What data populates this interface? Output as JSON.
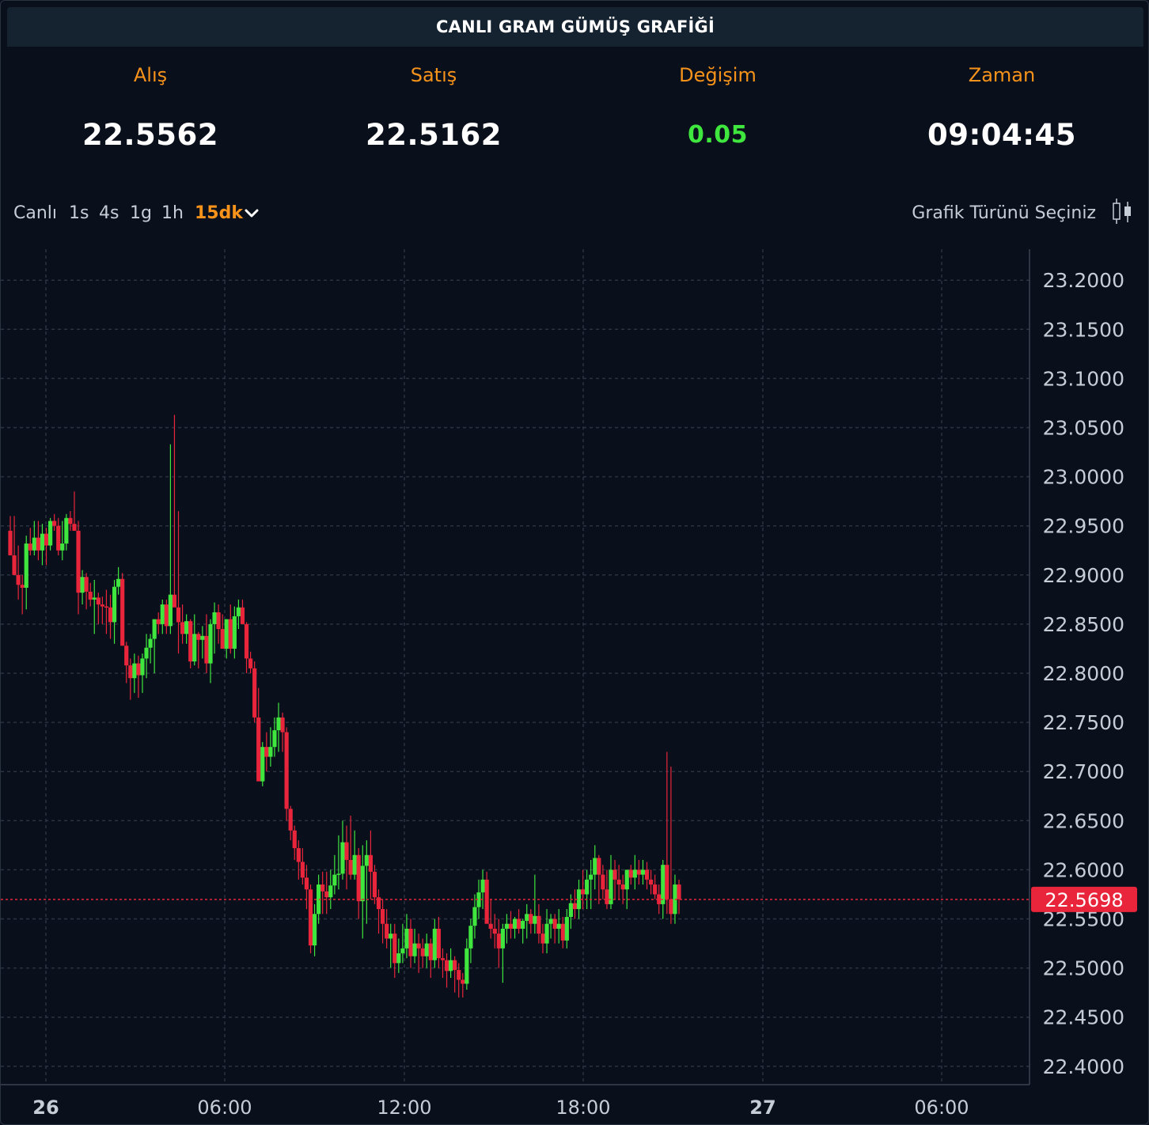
{
  "header": {
    "title": "CANLI GRAM GÜMÜŞ GRAFİĞİ"
  },
  "stats": {
    "buy_label": "Alış",
    "buy_value": "22.5562",
    "sell_label": "Satış",
    "sell_value": "22.5162",
    "change_label": "Değişim",
    "change_value": "0.05",
    "time_label": "Zaman",
    "time_value": "09:04:45"
  },
  "toolbar": {
    "timeframes": [
      "Canlı",
      "1s",
      "4s",
      "1g",
      "1h",
      "15dk"
    ],
    "active_timeframe": "15dk",
    "chart_type_label": "Grafik Türünü Seçiniz",
    "dropdown_icon": "chevron-down-icon",
    "chart_type_icon": "candlestick-icon"
  },
  "colors": {
    "up": "#3ee63e",
    "down": "#e8253a",
    "accent": "#f7931a",
    "background": "#0a0f1c",
    "grid": "#2a3340",
    "current_price_bg": "#e8253a"
  },
  "chart_data": {
    "type": "candlestick",
    "interval": "15dk",
    "y_ticks": [
      "23.2000",
      "23.1500",
      "23.1000",
      "23.0500",
      "23.0000",
      "22.9500",
      "22.9000",
      "22.8500",
      "22.8000",
      "22.7500",
      "22.7000",
      "22.6500",
      "22.6000",
      "22.5500",
      "22.5000",
      "22.4500",
      "22.4000"
    ],
    "ylim": [
      22.39,
      23.225
    ],
    "x_ticks": [
      "26",
      "06:00",
      "12:00",
      "18:00",
      "27",
      "06:00"
    ],
    "x_ticks_bold": [
      "26",
      "27"
    ],
    "current_price": "22.5698",
    "grid": true,
    "candles": [
      [
        22.945,
        22.96,
        22.92,
        22.92
      ],
      [
        22.92,
        22.96,
        22.9,
        22.9
      ],
      [
        22.9,
        22.93,
        22.875,
        22.89
      ],
      [
        22.89,
        22.9,
        22.86,
        22.887
      ],
      [
        22.887,
        22.94,
        22.865,
        22.932
      ],
      [
        22.932,
        22.948,
        22.92,
        22.925
      ],
      [
        22.925,
        22.955,
        22.92,
        22.938
      ],
      [
        22.938,
        22.955,
        22.915,
        22.925
      ],
      [
        22.925,
        22.952,
        22.91,
        22.942
      ],
      [
        22.942,
        22.948,
        22.91,
        22.93
      ],
      [
        22.93,
        22.958,
        22.925,
        22.955
      ],
      [
        22.955,
        22.962,
        22.945,
        22.95
      ],
      [
        22.95,
        22.958,
        22.92,
        22.925
      ],
      [
        22.925,
        22.955,
        22.915,
        22.932
      ],
      [
        22.932,
        22.962,
        22.925,
        22.958
      ],
      [
        22.958,
        22.965,
        22.945,
        22.952
      ],
      [
        22.952,
        22.985,
        22.945,
        22.945
      ],
      [
        22.945,
        22.955,
        22.86,
        22.882
      ],
      [
        22.882,
        22.905,
        22.87,
        22.898
      ],
      [
        22.898,
        22.902,
        22.865,
        22.883
      ],
      [
        22.883,
        22.892,
        22.868,
        22.875
      ],
      [
        22.875,
        22.895,
        22.84,
        22.877
      ],
      [
        22.877,
        22.882,
        22.85,
        22.87
      ],
      [
        22.87,
        22.878,
        22.85,
        22.868
      ],
      [
        22.868,
        22.885,
        22.84,
        22.867
      ],
      [
        22.867,
        22.88,
        22.835,
        22.852
      ],
      [
        22.852,
        22.895,
        22.83,
        22.888
      ],
      [
        22.888,
        22.908,
        22.88,
        22.896
      ],
      [
        22.896,
        22.902,
        22.89,
        22.828
      ],
      [
        22.828,
        22.832,
        22.79,
        22.808
      ],
      [
        22.808,
        22.815,
        22.773,
        22.795
      ],
      [
        22.795,
        22.82,
        22.78,
        22.81
      ],
      [
        22.81,
        22.818,
        22.775,
        22.798
      ],
      [
        22.798,
        22.82,
        22.78,
        22.815
      ],
      [
        22.815,
        22.84,
        22.795,
        22.826
      ],
      [
        22.826,
        22.84,
        22.81,
        22.835
      ],
      [
        22.835,
        22.855,
        22.8,
        22.855
      ],
      [
        22.855,
        22.862,
        22.84,
        22.85
      ],
      [
        22.85,
        22.875,
        22.84,
        22.87
      ],
      [
        22.87,
        22.875,
        22.84,
        22.848
      ],
      [
        22.848,
        23.033,
        22.84,
        22.88
      ],
      [
        22.88,
        23.063,
        22.87,
        22.867
      ],
      [
        22.867,
        22.965,
        22.82,
        22.852
      ],
      [
        22.852,
        22.87,
        22.83,
        22.84
      ],
      [
        22.84,
        22.86,
        22.83,
        22.853
      ],
      [
        22.853,
        22.855,
        22.805,
        22.812
      ],
      [
        22.812,
        22.86,
        22.808,
        22.84
      ],
      [
        22.84,
        22.842,
        22.805,
        22.834
      ],
      [
        22.834,
        22.848,
        22.815,
        22.838
      ],
      [
        22.838,
        22.86,
        22.8,
        22.81
      ],
      [
        22.81,
        22.855,
        22.79,
        22.85
      ],
      [
        22.85,
        22.872,
        22.82,
        22.862
      ],
      [
        22.862,
        22.87,
        22.83,
        22.845
      ],
      [
        22.845,
        22.86,
        22.83,
        22.825
      ],
      [
        22.825,
        22.855,
        22.815,
        22.855
      ],
      [
        22.855,
        22.87,
        22.82,
        22.825
      ],
      [
        22.825,
        22.868,
        22.815,
        22.858
      ],
      [
        22.858,
        22.875,
        22.845,
        22.867
      ],
      [
        22.867,
        22.875,
        22.85,
        22.85
      ],
      [
        22.85,
        22.852,
        22.8,
        22.815
      ],
      [
        22.815,
        22.822,
        22.8,
        22.805
      ],
      [
        22.805,
        22.812,
        22.75,
        22.755
      ],
      [
        22.755,
        22.785,
        22.69,
        22.69
      ],
      [
        22.69,
        22.73,
        22.685,
        22.725
      ],
      [
        22.725,
        22.74,
        22.7,
        22.715
      ],
      [
        22.715,
        22.745,
        22.705,
        22.725
      ],
      [
        22.725,
        22.755,
        22.715,
        22.742
      ],
      [
        22.742,
        22.77,
        22.72,
        22.755
      ],
      [
        22.755,
        22.76,
        22.72,
        22.74
      ],
      [
        22.74,
        22.745,
        22.65,
        22.662
      ],
      [
        22.662,
        22.665,
        22.63,
        22.64
      ],
      [
        22.64,
        22.645,
        22.61,
        22.622
      ],
      [
        22.622,
        22.63,
        22.59,
        22.608
      ],
      [
        22.608,
        22.622,
        22.585,
        22.592
      ],
      [
        22.592,
        22.605,
        22.56,
        22.58
      ],
      [
        22.58,
        22.585,
        22.515,
        22.523
      ],
      [
        22.523,
        22.565,
        22.512,
        22.555
      ],
      [
        22.555,
        22.595,
        22.545,
        22.585
      ],
      [
        22.585,
        22.598,
        22.555,
        22.578
      ],
      [
        22.578,
        22.598,
        22.555,
        22.572
      ],
      [
        22.572,
        22.6,
        22.56,
        22.584
      ],
      [
        22.584,
        22.615,
        22.575,
        22.595
      ],
      [
        22.595,
        22.635,
        22.58,
        22.596
      ],
      [
        22.596,
        22.65,
        22.59,
        22.628
      ],
      [
        22.628,
        22.645,
        22.58,
        22.61
      ],
      [
        22.61,
        22.655,
        22.59,
        22.595
      ],
      [
        22.595,
        22.64,
        22.59,
        22.615
      ],
      [
        22.615,
        22.622,
        22.55,
        22.568
      ],
      [
        22.568,
        22.625,
        22.53,
        22.604
      ],
      [
        22.604,
        22.63,
        22.545,
        22.615
      ],
      [
        22.615,
        22.64,
        22.57,
        22.598
      ],
      [
        22.598,
        22.605,
        22.565,
        22.572
      ],
      [
        22.572,
        22.58,
        22.535,
        22.56
      ],
      [
        22.56,
        22.57,
        22.525,
        22.545
      ],
      [
        22.545,
        22.56,
        22.52,
        22.53
      ],
      [
        22.53,
        22.545,
        22.5,
        22.535
      ],
      [
        22.535,
        22.545,
        22.49,
        22.505
      ],
      [
        22.505,
        22.53,
        22.495,
        22.515
      ],
      [
        22.515,
        22.545,
        22.505,
        22.52
      ],
      [
        22.52,
        22.555,
        22.51,
        22.54
      ],
      [
        22.54,
        22.55,
        22.5,
        22.512
      ],
      [
        22.512,
        22.54,
        22.505,
        22.525
      ],
      [
        22.525,
        22.535,
        22.495,
        22.52
      ],
      [
        22.52,
        22.53,
        22.5,
        22.512
      ],
      [
        22.512,
        22.535,
        22.5,
        22.525
      ],
      [
        22.525,
        22.53,
        22.49,
        22.508
      ],
      [
        22.508,
        22.55,
        22.5,
        22.54
      ],
      [
        22.54,
        22.552,
        22.5,
        22.51
      ],
      [
        22.51,
        22.52,
        22.49,
        22.508
      ],
      [
        22.508,
        22.515,
        22.48,
        22.497
      ],
      [
        22.497,
        22.52,
        22.49,
        22.508
      ],
      [
        22.508,
        22.512,
        22.475,
        22.498
      ],
      [
        22.498,
        22.505,
        22.47,
        22.488
      ],
      [
        22.488,
        22.495,
        22.47,
        22.484
      ],
      [
        22.484,
        22.53,
        22.478,
        22.52
      ],
      [
        22.52,
        22.55,
        22.505,
        22.543
      ],
      [
        22.543,
        22.575,
        22.53,
        22.562
      ],
      [
        22.562,
        22.59,
        22.55,
        22.577
      ],
      [
        22.577,
        22.6,
        22.56,
        22.59
      ],
      [
        22.59,
        22.598,
        22.56,
        22.545
      ],
      [
        22.545,
        22.57,
        22.53,
        22.54
      ],
      [
        22.54,
        22.555,
        22.52,
        22.535
      ],
      [
        22.535,
        22.55,
        22.5,
        22.52
      ],
      [
        22.52,
        22.545,
        22.485,
        22.54
      ],
      [
        22.54,
        22.555,
        22.525,
        22.545
      ],
      [
        22.545,
        22.558,
        22.53,
        22.54
      ],
      [
        22.54,
        22.552,
        22.53,
        22.55
      ],
      [
        22.55,
        22.56,
        22.535,
        22.54
      ],
      [
        22.54,
        22.55,
        22.525,
        22.548
      ],
      [
        22.548,
        22.565,
        22.53,
        22.555
      ],
      [
        22.555,
        22.56,
        22.535,
        22.545
      ],
      [
        22.545,
        22.595,
        22.535,
        22.553
      ],
      [
        22.553,
        22.565,
        22.525,
        22.535
      ],
      [
        22.535,
        22.545,
        22.515,
        22.525
      ],
      [
        22.525,
        22.56,
        22.515,
        22.545
      ],
      [
        22.545,
        22.555,
        22.53,
        22.55
      ],
      [
        22.55,
        22.555,
        22.525,
        22.54
      ],
      [
        22.54,
        22.56,
        22.525,
        22.545
      ],
      [
        22.545,
        22.552,
        22.52,
        22.528
      ],
      [
        22.528,
        22.56,
        22.52,
        22.552
      ],
      [
        22.552,
        22.575,
        22.54,
        22.566
      ],
      [
        22.566,
        22.58,
        22.55,
        22.56
      ],
      [
        22.56,
        22.59,
        22.55,
        22.58
      ],
      [
        22.58,
        22.6,
        22.56,
        22.575
      ],
      [
        22.575,
        22.6,
        22.56,
        22.59
      ],
      [
        22.59,
        22.61,
        22.56,
        22.595
      ],
      [
        22.595,
        22.625,
        22.58,
        22.612
      ],
      [
        22.612,
        22.615,
        22.565,
        22.595
      ],
      [
        22.595,
        22.605,
        22.57,
        22.58
      ],
      [
        22.58,
        22.6,
        22.56,
        22.565
      ],
      [
        22.565,
        22.615,
        22.56,
        22.6
      ],
      [
        22.6,
        22.61,
        22.57,
        22.59
      ],
      [
        22.59,
        22.605,
        22.57,
        22.585
      ],
      [
        22.585,
        22.595,
        22.565,
        22.58
      ],
      [
        22.58,
        22.6,
        22.56,
        22.6
      ],
      [
        22.6,
        22.605,
        22.585,
        22.592
      ],
      [
        22.592,
        22.615,
        22.58,
        22.6
      ],
      [
        22.6,
        22.61,
        22.585,
        22.595
      ],
      [
        22.595,
        22.61,
        22.585,
        22.6
      ],
      [
        22.6,
        22.608,
        22.58,
        22.59
      ],
      [
        22.59,
        22.6,
        22.575,
        22.585
      ],
      [
        22.585,
        22.595,
        22.57,
        22.575
      ],
      [
        22.575,
        22.585,
        22.555,
        22.565
      ],
      [
        22.565,
        22.61,
        22.55,
        22.605
      ],
      [
        22.605,
        22.72,
        22.555,
        22.57
      ],
      [
        22.57,
        22.705,
        22.545,
        22.555
      ],
      [
        22.555,
        22.595,
        22.545,
        22.585
      ],
      [
        22.585,
        22.59,
        22.555,
        22.57
      ]
    ]
  }
}
